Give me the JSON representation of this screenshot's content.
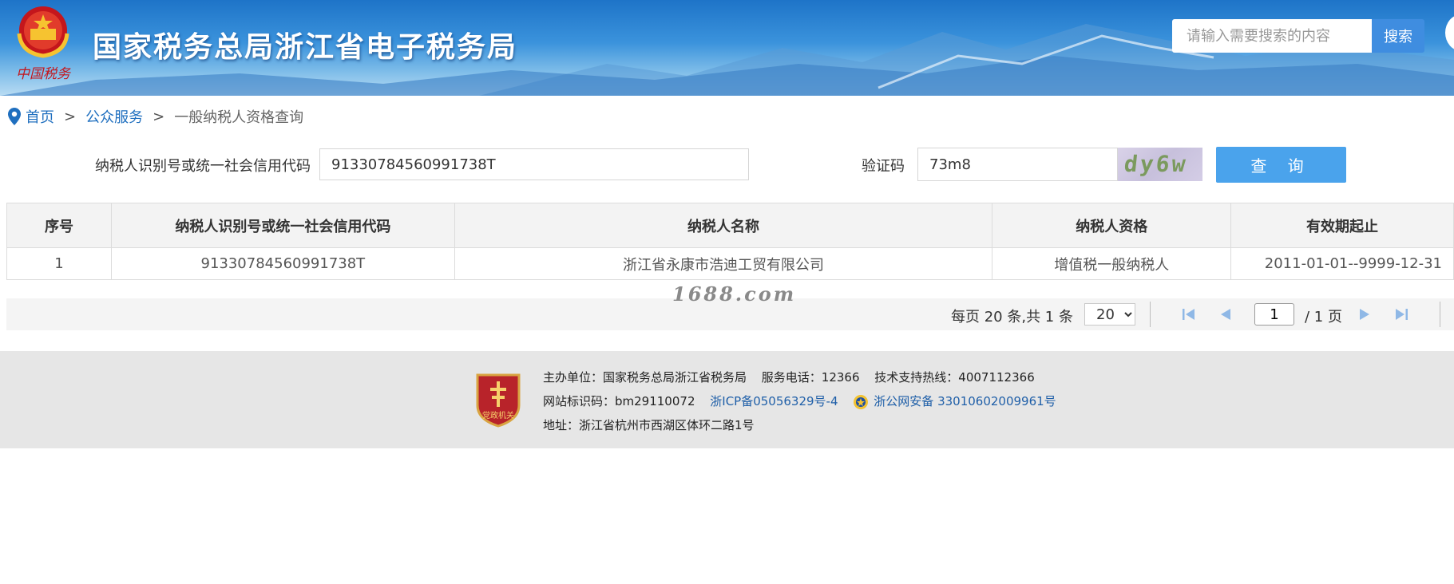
{
  "header": {
    "site_title": "国家税务总局浙江省电子税务局",
    "emblem_text": "中国税务",
    "search_placeholder": "请输入需要搜索的内容",
    "search_button": "搜索"
  },
  "breadcrumb": {
    "home": "首页",
    "sep1": ">",
    "public_service": "公众服务",
    "sep2": ">",
    "current": "一般纳税人资格查询"
  },
  "form": {
    "taxpayer_id_label": "纳税人识别号或统一社会信用代码",
    "taxpayer_id_value": "91330784560991738T",
    "captcha_label": "验证码",
    "captcha_value": "73m8",
    "captcha_image_text": "dy6w",
    "query_button": "查 询"
  },
  "table": {
    "headers": [
      "序号",
      "纳税人识别号或统一社会信用代码",
      "纳税人名称",
      "纳税人资格",
      "有效期起止"
    ],
    "rows": [
      [
        "1",
        "91330784560991738T",
        "浙江省永康市浩迪工贸有限公司",
        "增值税一般纳税人",
        "2011-01-01--9999-12-31"
      ]
    ]
  },
  "watermark": "1688.com",
  "pagination": {
    "info": "每页 20 条,共 1 条",
    "page_size": "20",
    "current_page": "1",
    "total_pages": "/ 1 页",
    "icons": [
      "first-page-icon",
      "prev-page-icon",
      "next-page-icon",
      "last-page-icon"
    ]
  },
  "footer": {
    "badge_text": "党政机关",
    "line1_host": "主办单位：国家税务总局浙江省税务局",
    "line1_phone": "服务电话：12366",
    "line1_hotline": "技术支持热线：4007112366",
    "line2_site_id": "网站标识码：bm29110072",
    "line2_icp": "浙ICP备05056329号-4",
    "line2_police": "浙公网安备 33010602009961号",
    "line3_address": "地址：浙江省杭州市西湖区体环二路1号"
  },
  "colors": {
    "brand_blue": "#1e74c8",
    "link_blue": "#1f6fbf",
    "query_button": "#4aa3ec",
    "search_button": "#3f8de0",
    "footer_bg": "#e6e6e6"
  }
}
